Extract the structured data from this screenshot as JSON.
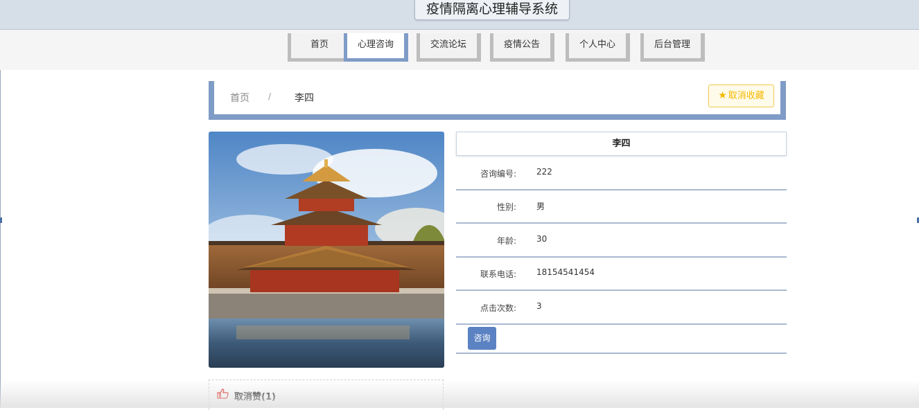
{
  "header": {
    "title": "疫情隔离心理辅导系统"
  },
  "nav": {
    "items": [
      {
        "label": "首页"
      },
      {
        "label": "心理咨询"
      },
      {
        "label": "交流论坛"
      },
      {
        "label": "疫情公告"
      },
      {
        "label": "个人中心"
      },
      {
        "label": "后台管理"
      }
    ],
    "active": "心理咨询"
  },
  "breadcrumb": {
    "home": "首页",
    "separator": "/",
    "current": "李四"
  },
  "favorite": {
    "label": "取消收藏",
    "icon": "star-icon",
    "color": "#f5b800"
  },
  "detail": {
    "name": "李四",
    "fields": [
      {
        "label": "咨询编号:",
        "value": "222"
      },
      {
        "label": "性别:",
        "value": "男"
      },
      {
        "label": "年龄:",
        "value": "30"
      },
      {
        "label": "联系电话:",
        "value": "18154541454"
      },
      {
        "label": "点击次数:",
        "value": "3"
      }
    ],
    "consult_button": "咨询"
  },
  "like": {
    "label": "取消赞(1)",
    "icon": "thumbs-up-icon",
    "color": "#e53935"
  },
  "colors": {
    "accent": "#7f9cc7",
    "button": "#5b82c2",
    "header_bg": "#d6dee8"
  }
}
